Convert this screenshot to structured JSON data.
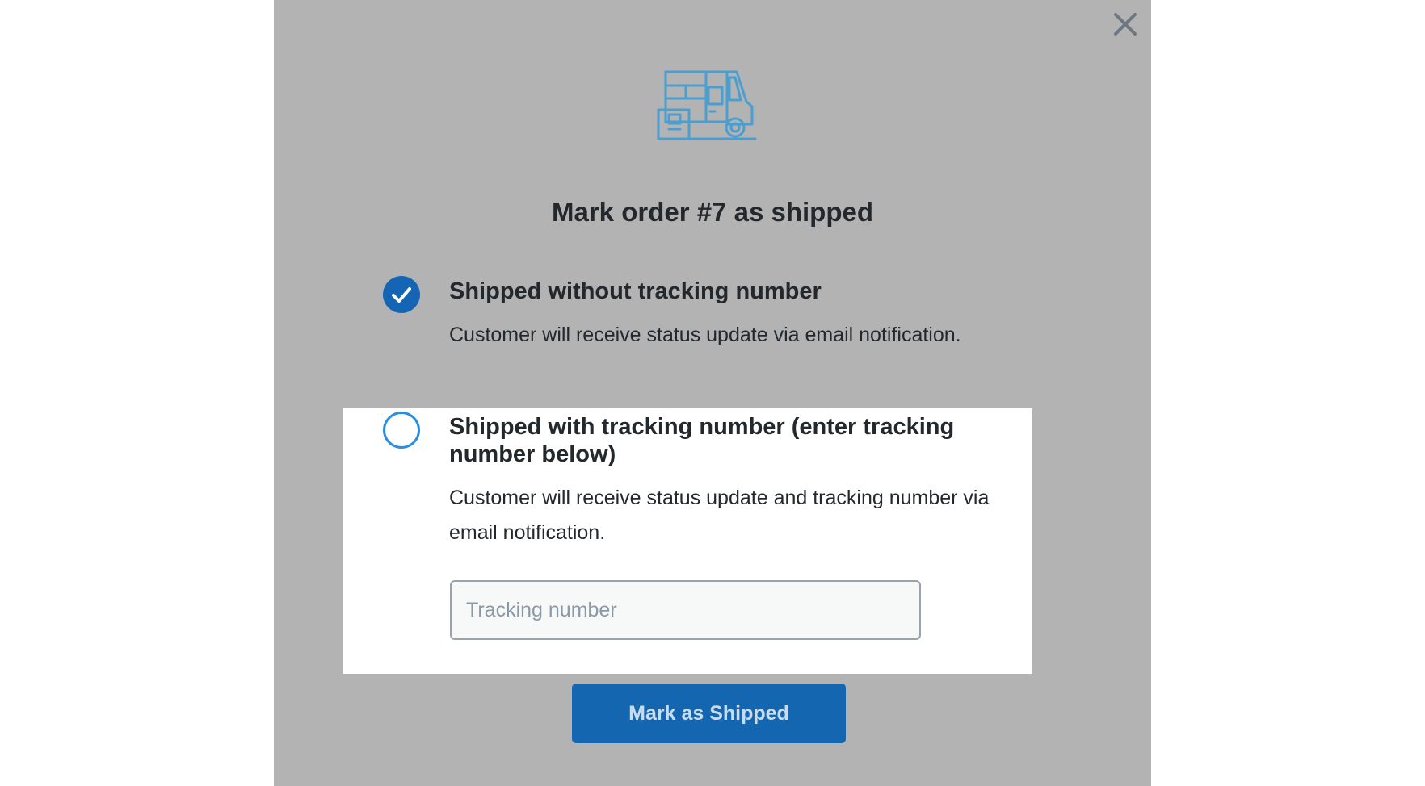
{
  "modal": {
    "title": "Mark order #7 as shipped",
    "close_icon": "close-icon",
    "header_icon": "delivery-truck-icon"
  },
  "options": [
    {
      "title": "Shipped without tracking number",
      "description": "Customer will receive status update via email notification.",
      "selected": true
    },
    {
      "title": "Shipped with tracking number (enter tracking number below)",
      "description": "Customer will receive status update and tracking number via email notification.",
      "selected": false
    }
  ],
  "tracking": {
    "placeholder": "Tracking number",
    "value": ""
  },
  "actions": {
    "submit_label": "Mark as Shipped"
  },
  "colors": {
    "overlay_bg": "#b3b3b3",
    "accent": "#1565b5",
    "icon_stroke": "#4a9fd0",
    "radio_border": "#2a8ee0",
    "highlight_bg": "#ffffff"
  }
}
